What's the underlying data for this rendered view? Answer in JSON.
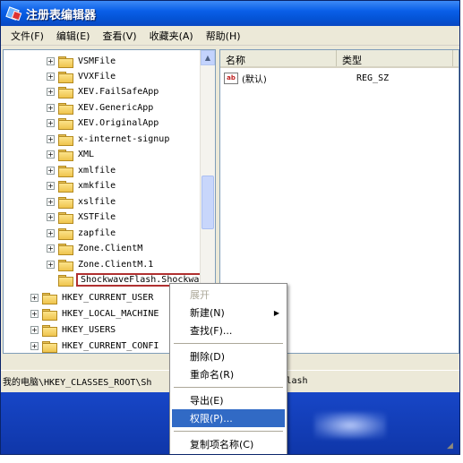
{
  "window": {
    "title": "注册表编辑器",
    "icon": "regedit-icon"
  },
  "menu": [
    {
      "label": "文件(F)"
    },
    {
      "label": "编辑(E)"
    },
    {
      "label": "查看(V)"
    },
    {
      "label": "收藏夹(A)"
    },
    {
      "label": "帮助(H)"
    }
  ],
  "tree": {
    "items": [
      {
        "label": "VSMFile",
        "expander": "+"
      },
      {
        "label": "VVXFile",
        "expander": "+"
      },
      {
        "label": "XEV.FailSafeApp",
        "expander": "+"
      },
      {
        "label": "XEV.GenericApp",
        "expander": "+"
      },
      {
        "label": "XEV.OriginalApp",
        "expander": "+"
      },
      {
        "label": "x-internet-signup",
        "expander": "+"
      },
      {
        "label": "XML",
        "expander": "+"
      },
      {
        "label": "xmlfile",
        "expander": "+"
      },
      {
        "label": "xmkfile",
        "expander": "+"
      },
      {
        "label": "xslfile",
        "expander": "+"
      },
      {
        "label": "XSTFile",
        "expander": "+"
      },
      {
        "label": "zapfile",
        "expander": "+"
      },
      {
        "label": "Zone.ClientM",
        "expander": "+"
      },
      {
        "label": "Zone.ClientM.1",
        "expander": "+"
      }
    ],
    "selected": "ShockwaveFlash.ShockwaveFlash",
    "hives": [
      {
        "label": "HKEY_CURRENT_USER",
        "expander": "+"
      },
      {
        "label": "HKEY_LOCAL_MACHINE",
        "expander": "+"
      },
      {
        "label": "HKEY_USERS",
        "expander": "+"
      },
      {
        "label": "HKEY_CURRENT_CONFI",
        "expander": "+"
      }
    ]
  },
  "list": {
    "columns": {
      "name": "名称",
      "type": "类型"
    },
    "rows": [
      {
        "name": "(默认)",
        "type": "REG_SZ",
        "icon": "ab-icon"
      }
    ]
  },
  "statusbar": {
    "path_left": "我的电脑\\HKEY_CLASSES_ROOT\\Sh",
    "path_right": "veFlash"
  },
  "context_menu": {
    "items": [
      {
        "label": "展开",
        "disabled": true
      },
      {
        "label": "新建(N)",
        "submenu": "▶"
      },
      {
        "label": "查找(F)..."
      },
      {
        "label": "删除(D)"
      },
      {
        "label": "重命名(R)"
      },
      {
        "label": "导出(E)"
      },
      {
        "label": "权限(P)...",
        "highlighted": true
      },
      {
        "label": "复制项名称(C)"
      }
    ]
  },
  "colors": {
    "titlebar": "#0a5fe8",
    "highlight": "#316ac5",
    "selection_border": "#b03030",
    "desktop": "#1746c7"
  }
}
